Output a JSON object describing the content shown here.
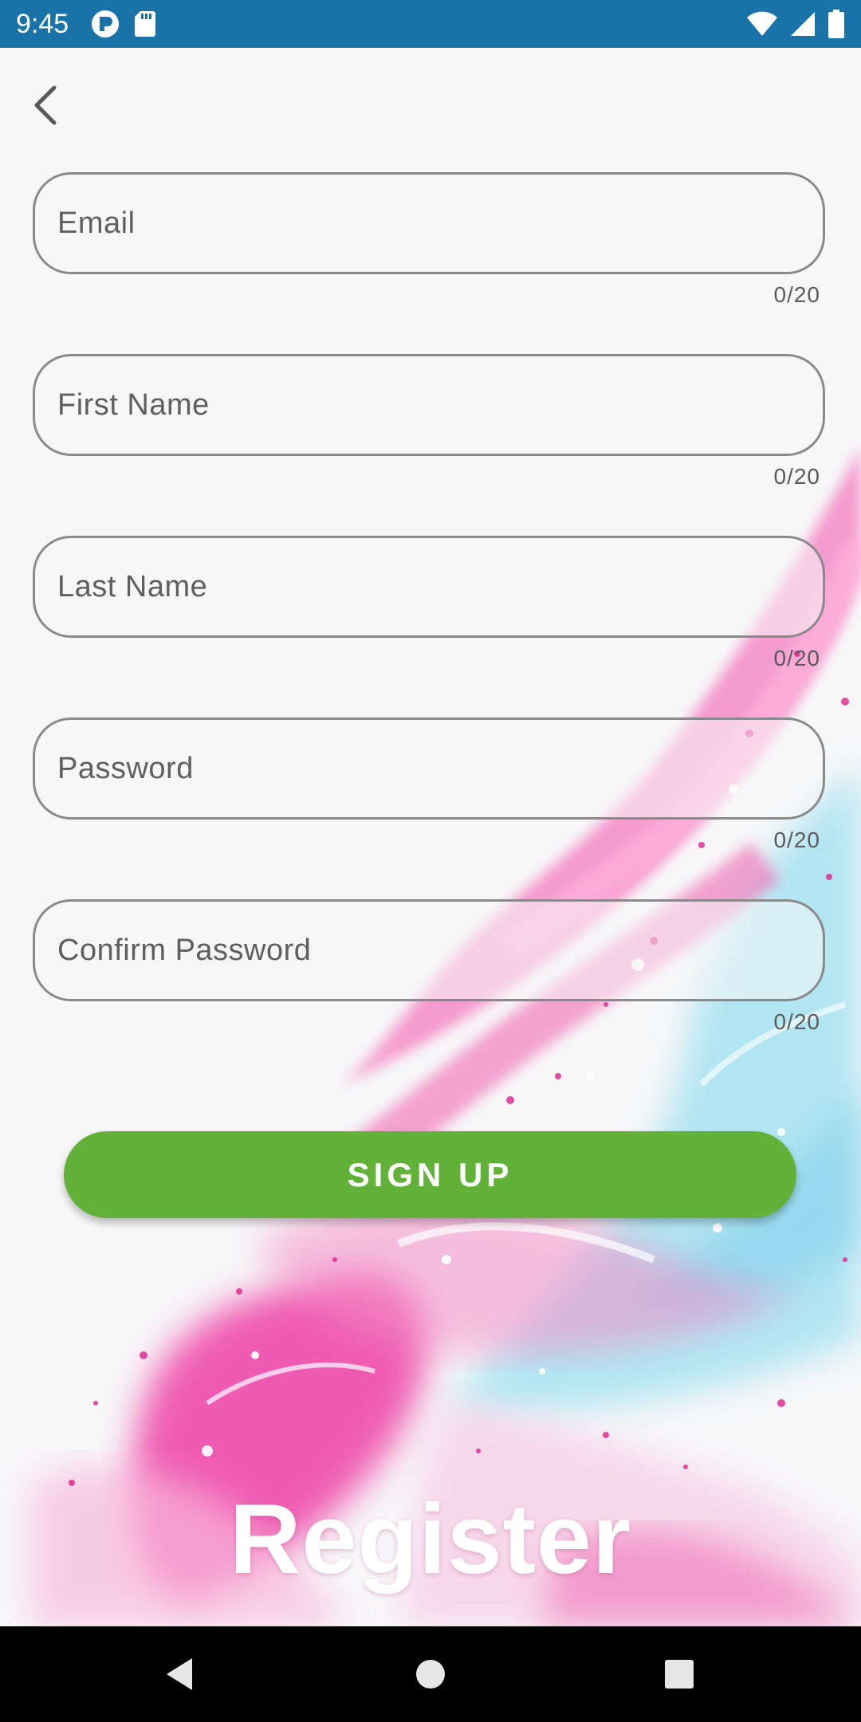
{
  "status_bar": {
    "time": "9:45",
    "left_icons": [
      "p-app-icon",
      "sd-card-icon"
    ],
    "right_icons": [
      "wifi-icon",
      "signal-icon",
      "battery-icon"
    ]
  },
  "form": {
    "fields": [
      {
        "placeholder": "Email",
        "counter": "0/20"
      },
      {
        "placeholder": "First Name",
        "counter": "0/20"
      },
      {
        "placeholder": "Last Name",
        "counter": "0/20"
      },
      {
        "placeholder": "Password",
        "counter": "0/20"
      },
      {
        "placeholder": "Confirm Password",
        "counter": "0/20"
      }
    ],
    "submit_label": "SIGN UP"
  },
  "title": "Register",
  "colors": {
    "status_bar": "#1a73a8",
    "button": "#62b23a",
    "field_border": "#8a8a8a",
    "accent_pink": "#ee3fa6",
    "accent_blue": "#7fd3ea"
  },
  "nav_bar": {
    "icons": [
      "back-triangle-icon",
      "home-circle-icon",
      "recents-square-icon"
    ]
  }
}
